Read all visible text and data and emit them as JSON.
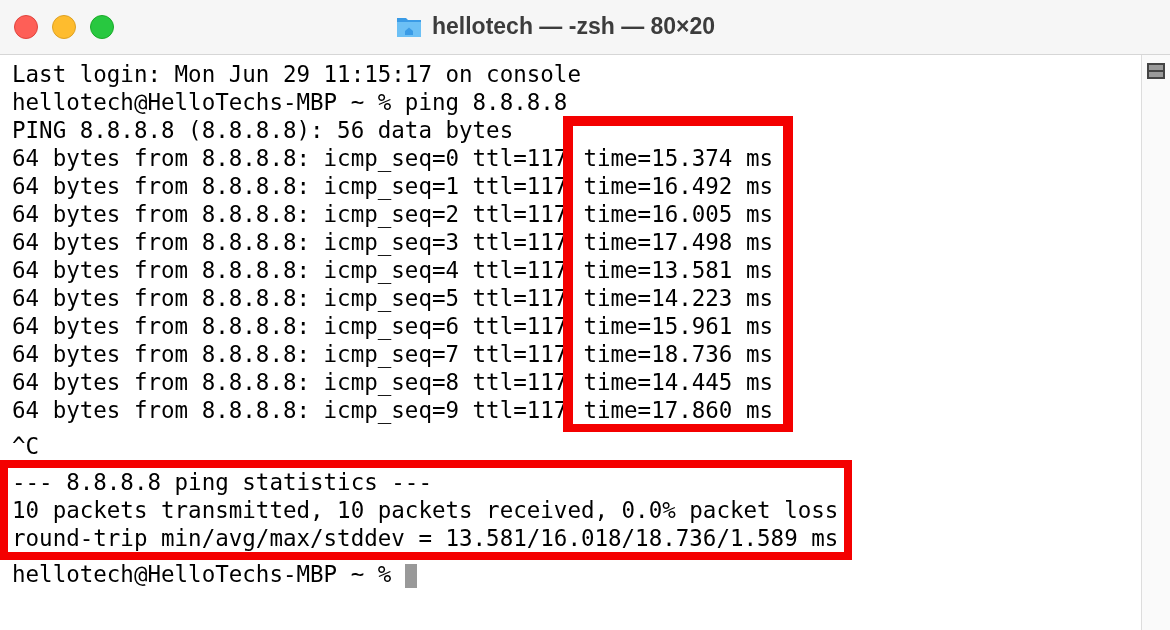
{
  "window": {
    "title": "hellotech — -zsh — 80×20"
  },
  "terminal": {
    "header_lines": [
      "Last login: Mon Jun 29 11:15:17 on console",
      "hellotech@HelloTechs-MBP ~ % ping 8.8.8.8",
      "PING 8.8.8.8 (8.8.8.8): 56 data bytes"
    ],
    "highlight_times": true,
    "ping_replies": [
      {
        "prefix": "64 bytes from 8.8.8.8: icmp_seq=0 ttl=117",
        "time": "time=15.374 ms"
      },
      {
        "prefix": "64 bytes from 8.8.8.8: icmp_seq=1 ttl=117",
        "time": "time=16.492 ms"
      },
      {
        "prefix": "64 bytes from 8.8.8.8: icmp_seq=2 ttl=117",
        "time": "time=16.005 ms"
      },
      {
        "prefix": "64 bytes from 8.8.8.8: icmp_seq=3 ttl=117",
        "time": "time=17.498 ms"
      },
      {
        "prefix": "64 bytes from 8.8.8.8: icmp_seq=4 ttl=117",
        "time": "time=13.581 ms"
      },
      {
        "prefix": "64 bytes from 8.8.8.8: icmp_seq=5 ttl=117",
        "time": "time=14.223 ms"
      },
      {
        "prefix": "64 bytes from 8.8.8.8: icmp_seq=6 ttl=117",
        "time": "time=15.961 ms"
      },
      {
        "prefix": "64 bytes from 8.8.8.8: icmp_seq=7 ttl=117",
        "time": "time=18.736 ms"
      },
      {
        "prefix": "64 bytes from 8.8.8.8: icmp_seq=8 ttl=117",
        "time": "time=14.445 ms"
      },
      {
        "prefix": "64 bytes from 8.8.8.8: icmp_seq=9 ttl=117",
        "time": "time=17.860 ms"
      }
    ],
    "interrupt": "^C",
    "highlight_statistics": true,
    "statistics_lines": [
      "--- 8.8.8.8 ping statistics ---",
      "10 packets transmitted, 10 packets received, 0.0% packet loss",
      "round-trip min/avg/max/stddev = 13.581/16.018/18.736/1.589 ms"
    ],
    "prompt": "hellotech@HelloTechs-MBP ~ %"
  }
}
